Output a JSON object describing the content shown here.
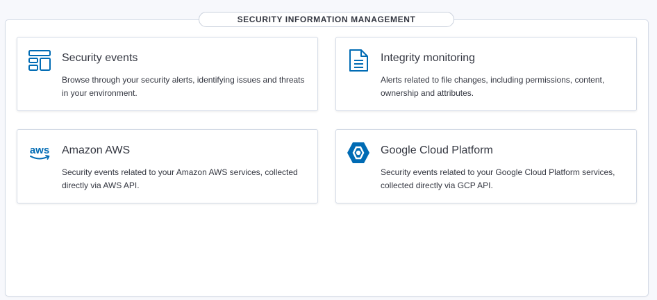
{
  "panel": {
    "title": "SECURITY INFORMATION MANAGEMENT"
  },
  "cards": [
    {
      "icon": "dashboard-layout-icon",
      "title": "Security events",
      "description": "Browse through your security alerts, identifying issues and threats in your environment."
    },
    {
      "icon": "document-icon",
      "title": "Integrity monitoring",
      "description": "Alerts related to file changes, including permissions, content, ownership and attributes."
    },
    {
      "icon": "aws-logo-icon",
      "icon_text": "aws",
      "title": "Amazon AWS",
      "description": "Security events related to your Amazon AWS services, collected directly via AWS API."
    },
    {
      "icon": "gcp-logo-icon",
      "title": "Google Cloud Platform",
      "description": "Security events related to your Google Cloud Platform services, collected directly via GCP API."
    }
  ],
  "colors": {
    "accent": "#006bb4",
    "text": "#343741",
    "border": "#d3dae6",
    "background": "#f7f8fc"
  }
}
